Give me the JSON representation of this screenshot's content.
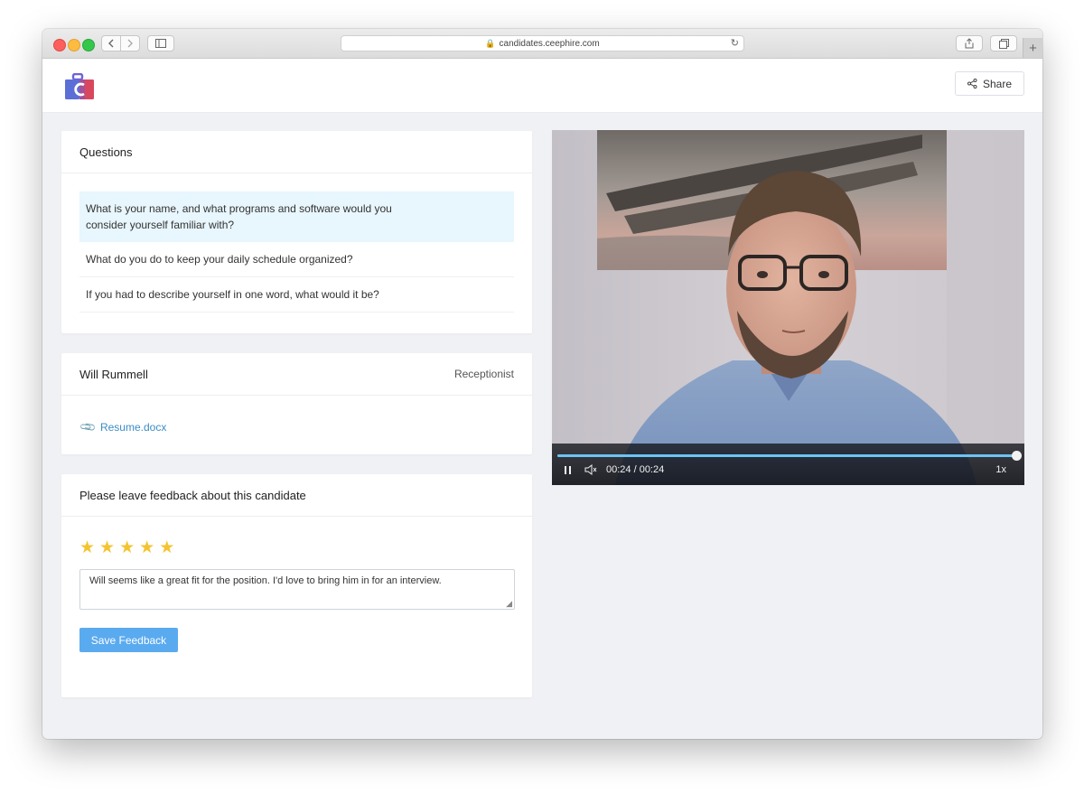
{
  "browser": {
    "url": "candidates.ceephire.com"
  },
  "header": {
    "share_label": "Share"
  },
  "questions": {
    "title": "Questions",
    "items": [
      "What is your name, and what programs and software would you consider yourself familiar with?",
      "What do you do to keep your daily schedule organized?",
      "If you had to describe yourself in one word, what would it be?"
    ],
    "active_index": 0
  },
  "candidate": {
    "name": "Will Rummell",
    "role": "Receptionist",
    "attachment": "Resume.docx"
  },
  "feedback": {
    "title": "Please leave feedback about this candidate",
    "rating": 5,
    "rating_max": 5,
    "comment": "Will seems like a great fit for the position. I'd love to bring him in for an interview.",
    "save_label": "Save Feedback"
  },
  "video": {
    "time_display": "00:24 / 00:24",
    "progress": 1.0,
    "speed": "1x"
  },
  "colors": {
    "accent_button": "#5aaaf0",
    "link": "#3b8dc5",
    "star": "#f4c430",
    "active_question_bg": "#e8f6fd",
    "progress": "#6cc4f5"
  }
}
